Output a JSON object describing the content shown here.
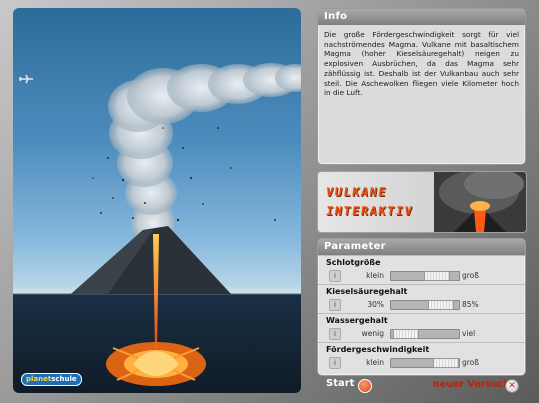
{
  "info": {
    "title": "Info",
    "text": "Die große Fördergeschwindigkeit sorgt für viel nachströmendes Magma. Vulkane mit basaltischem Magma (hoher Kieselsäuregehalt) neigen zu explosiven Ausbrüchen, da das Magma sehr zähflüssig ist. Deshalb ist der Vulkanbau auch sehr steil. Die Aschewolken fliegen viele Kilometer hoch in die Luft."
  },
  "banner": {
    "line1": "VULKANE",
    "line2": "INTERAKTIV"
  },
  "logo": {
    "part1": "planet",
    "part2": "schule"
  },
  "parameters": {
    "title": "Parameter",
    "items": [
      {
        "label": "Schlotgröße",
        "low": "klein",
        "high": "groß",
        "level": 0.75
      },
      {
        "label": "Kieselsäuregehalt",
        "low": "30%",
        "high": "85%",
        "level": 0.85
      },
      {
        "label": "Wassergehalt",
        "low": "wenig",
        "high": "viel",
        "level": 0.05
      },
      {
        "label": "Fördergeschwindigkeit",
        "low": "klein",
        "high": "groß",
        "level": 0.95
      }
    ]
  },
  "actions": {
    "start": "Start",
    "restart": "neuer Versuch"
  },
  "colors": {
    "accent": "#e9541b",
    "lava": "#ff8a1e",
    "panel": "#dcdcdc"
  }
}
